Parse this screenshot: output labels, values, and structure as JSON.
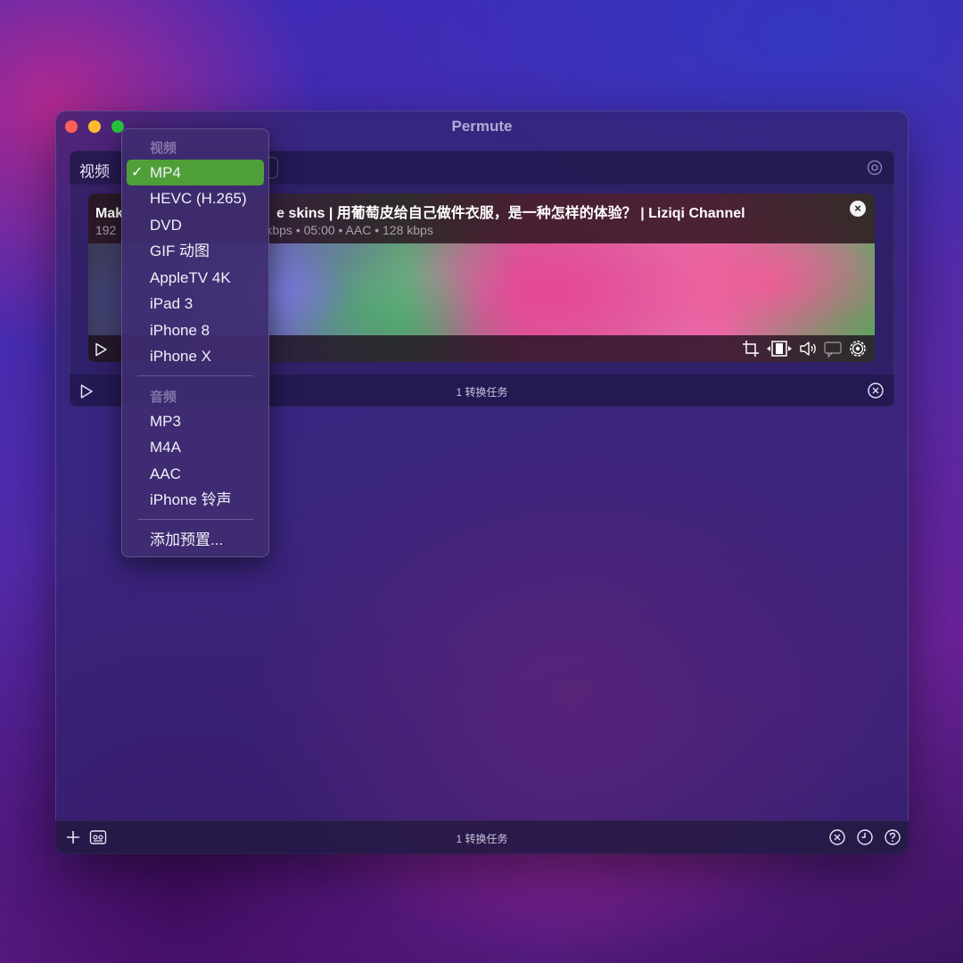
{
  "window": {
    "title": "Permute"
  },
  "group": {
    "label": "视频",
    "footer_text": "1 转换任务"
  },
  "item": {
    "title": "Mak",
    "title_rest": "e skins | 用葡萄皮给自己做件衣服，是一种怎样的体验？ | Liziqi Channel",
    "meta_prefix": "192",
    "meta_rest": "kbps • 05:00 • AAC • 128 kbps"
  },
  "bottom_bar": {
    "status_text": "1 转换任务"
  },
  "menu": {
    "video_section": "视频",
    "video_items": [
      {
        "label": "MP4",
        "selected": true
      },
      {
        "label": "HEVC (H.265)"
      },
      {
        "label": "DVD"
      },
      {
        "label": "GIF 动图"
      },
      {
        "label": "AppleTV 4K"
      },
      {
        "label": "iPad 3"
      },
      {
        "label": "iPhone 8"
      },
      {
        "label": "iPhone X"
      }
    ],
    "audio_section": "音频",
    "audio_items": [
      {
        "label": "MP3"
      },
      {
        "label": "M4A"
      },
      {
        "label": "AAC"
      },
      {
        "label": "iPhone 铃声"
      }
    ],
    "add_preset": "添加预置...",
    "check_mark": "✓"
  },
  "colors": {
    "selected_item": "#4f9f38",
    "traffic_red": "#fe5f57",
    "traffic_yellow": "#febc2e",
    "traffic_green": "#28c840"
  }
}
